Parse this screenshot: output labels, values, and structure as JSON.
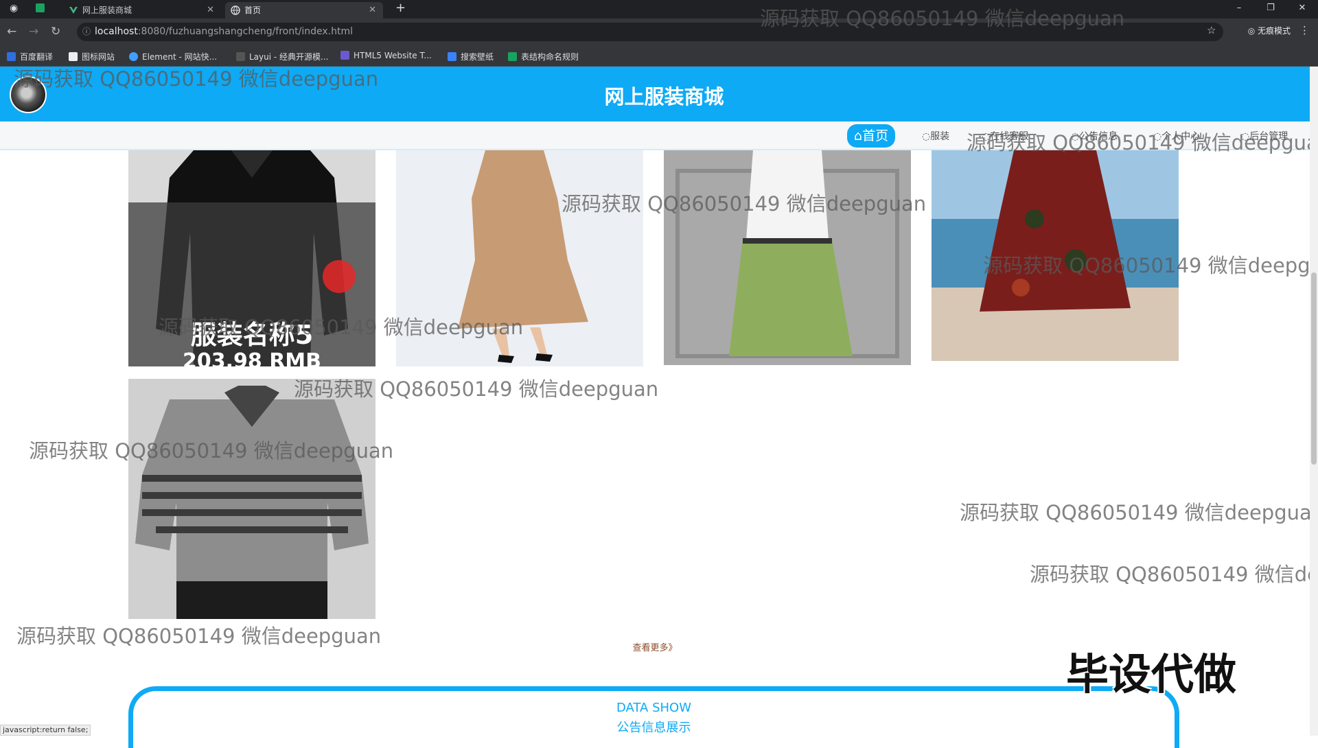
{
  "browser": {
    "tabs": [
      {
        "label": "网上服装商城"
      },
      {
        "label": "首页"
      }
    ],
    "url_host": "localhost",
    "url_path": ":8080/fuzhuangshangcheng/front/index.html",
    "incognito_label": "无痕模式",
    "bookmarks": [
      "百度翻译",
      "图标网站",
      "Element - 网站快...",
      "Layui - 经典开源模...",
      "HTML5 Website T...",
      "搜索壁纸",
      "表结构命名规则"
    ]
  },
  "site": {
    "title": "网上服装商城",
    "nav": [
      "首页",
      "服装",
      "在线客服",
      "公告信息",
      "个人中心",
      "后台管理"
    ]
  },
  "products": [
    {
      "name": "服装名称5",
      "price": "203.98 RMB",
      "image": "black-jacket",
      "hovered": true
    },
    {
      "image": "tan-ruffle-dress"
    },
    {
      "image": "white-tee-green-skirt"
    },
    {
      "image": "floral-dress-seaside"
    },
    {
      "image": "striped-polo"
    }
  ],
  "more_label": "查看更多》",
  "data_show": {
    "en": "DATA SHOW",
    "cn": "公告信息展示"
  },
  "watermark": "源码获取 QQ86050149 微信deepguan",
  "promo_text": "毕设代做",
  "status_text": "javascript:return false;",
  "colors": {
    "primary": "#0eaaf5"
  }
}
